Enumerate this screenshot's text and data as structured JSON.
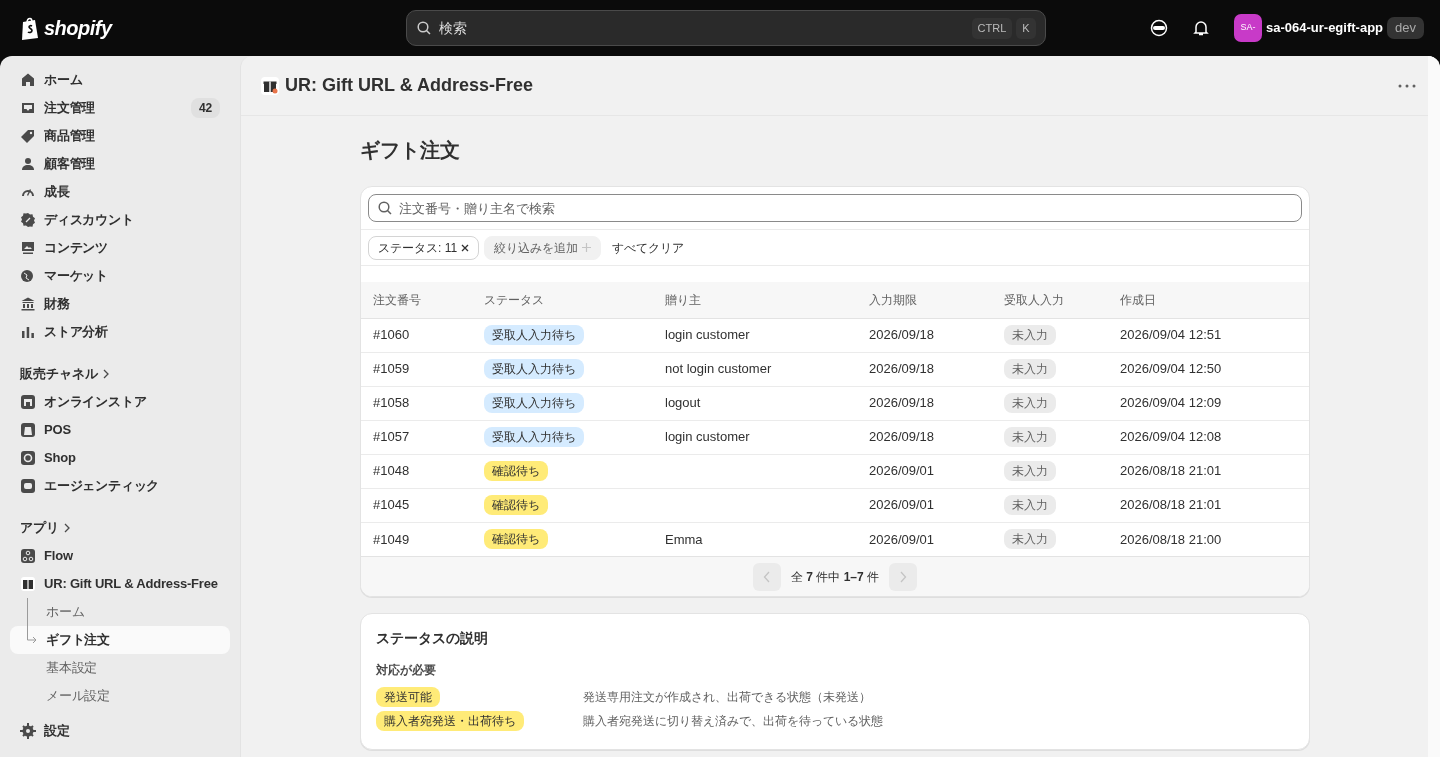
{
  "topbar": {
    "logo_text": "shopify",
    "search": {
      "placeholder": "検索"
    },
    "shortcut_keys": [
      "CTRL",
      "K"
    ],
    "store": {
      "avatar": "SA-",
      "name": "sa-064-ur-egift-app",
      "badge": "dev"
    }
  },
  "sidebar": {
    "items": [
      {
        "label": "ホーム",
        "selected": false
      },
      {
        "label": "注文管理",
        "count": "42",
        "selected": false
      },
      {
        "label": "商品管理",
        "selected": false
      },
      {
        "label": "顧客管理",
        "selected": false
      },
      {
        "label": "成長",
        "selected": false
      },
      {
        "label": "ディスカウント",
        "selected": false
      },
      {
        "label": "コンテンツ",
        "selected": false
      },
      {
        "label": "マーケット",
        "selected": false
      },
      {
        "label": "財務",
        "selected": false
      },
      {
        "label": "ストア分析",
        "selected": false
      }
    ],
    "sales_channels": {
      "title": "販売チャネル",
      "items": [
        {
          "label": "オンラインストア",
          "selected": false
        },
        {
          "label": "POS",
          "selected": false
        },
        {
          "label": "Shop",
          "selected": false
        },
        {
          "label": "エージェンティック",
          "selected": false
        }
      ]
    },
    "apps": {
      "title": "アプリ",
      "items": [
        {
          "label": "Flow",
          "selected": false
        },
        {
          "label": "UR: Gift URL & Address-Free",
          "selected": false,
          "children": [
            {
              "label": "ホーム",
              "selected": false
            },
            {
              "label": "ギフト注文",
              "selected": true
            },
            {
              "label": "基本設定",
              "selected": false
            },
            {
              "label": "メール設定",
              "selected": false
            }
          ]
        }
      ]
    },
    "settings": {
      "label": "設定",
      "selected": false
    }
  },
  "app_header": {
    "title": "UR: Gift URL & Address-Free"
  },
  "page_title": "ギフト注文",
  "orders": {
    "search": {
      "placeholder": "注文番号・贈り主名で検索"
    },
    "filters": [
      {
        "kind": "applied",
        "label": "ステータス: 11"
      },
      {
        "kind": "add",
        "label": "絞り込みを追加"
      }
    ],
    "clear_all": "すべてクリア",
    "columns": [
      "注文番号",
      "ステータス",
      "贈り主",
      "入力期限",
      "受取人入力",
      "作成日"
    ],
    "rows": [
      {
        "order": "#1060",
        "status": {
          "text": "受取人入力待ち",
          "color": "#d5ebff"
        },
        "giver": "login customer",
        "deadline": "2026/09/18",
        "recipient_input": "未入力",
        "created": "2026/09/04 12:51"
      },
      {
        "order": "#1059",
        "status": {
          "text": "受取人入力待ち",
          "color": "#d5ebff"
        },
        "giver": "not login customer",
        "deadline": "2026/09/18",
        "recipient_input": "未入力",
        "created": "2026/09/04 12:50"
      },
      {
        "order": "#1058",
        "status": {
          "text": "受取人入力待ち",
          "color": "#d5ebff"
        },
        "giver": "logout",
        "deadline": "2026/09/18",
        "recipient_input": "未入力",
        "created": "2026/09/04 12:09"
      },
      {
        "order": "#1057",
        "status": {
          "text": "受取人入力待ち",
          "color": "#d5ebff"
        },
        "giver": "login customer",
        "deadline": "2026/09/18",
        "recipient_input": "未入力",
        "created": "2026/09/04 12:08"
      },
      {
        "order": "#1048",
        "status": {
          "text": "確認待ち",
          "color": "#ffeb78"
        },
        "deadline": "2026/09/01",
        "recipient_input": "未入力",
        "created": "2026/08/18 21:01"
      },
      {
        "order": "#1045",
        "status": {
          "text": "確認待ち",
          "color": "#ffeb78"
        },
        "deadline": "2026/09/01",
        "recipient_input": "未入力",
        "created": "2026/08/18 21:01"
      },
      {
        "order": "#1049",
        "status": {
          "text": "確認待ち",
          "color": "#ffeb78"
        },
        "giver": "Emma",
        "deadline": "2026/09/01",
        "recipient_input": "未入力",
        "created": "2026/08/18 21:00"
      }
    ],
    "pagination": {
      "text": "全 **7** 件中 **1–7** 件",
      "prev_disabled": true,
      "next_disabled": true
    }
  },
  "status_legend": {
    "title": "ステータスの説明",
    "group": "対応が必要",
    "items": [
      {
        "badge": "発送可能",
        "color": "#ffeb78",
        "description": "発送専用注文が作成され、出荷できる状態（未発送）"
      },
      {
        "badge": "購入者宛発送・出荷待ち",
        "color": "#ffeb78",
        "description": "購入者宛発送に切り替え済みで、出荷を待っている状態"
      }
    ]
  }
}
